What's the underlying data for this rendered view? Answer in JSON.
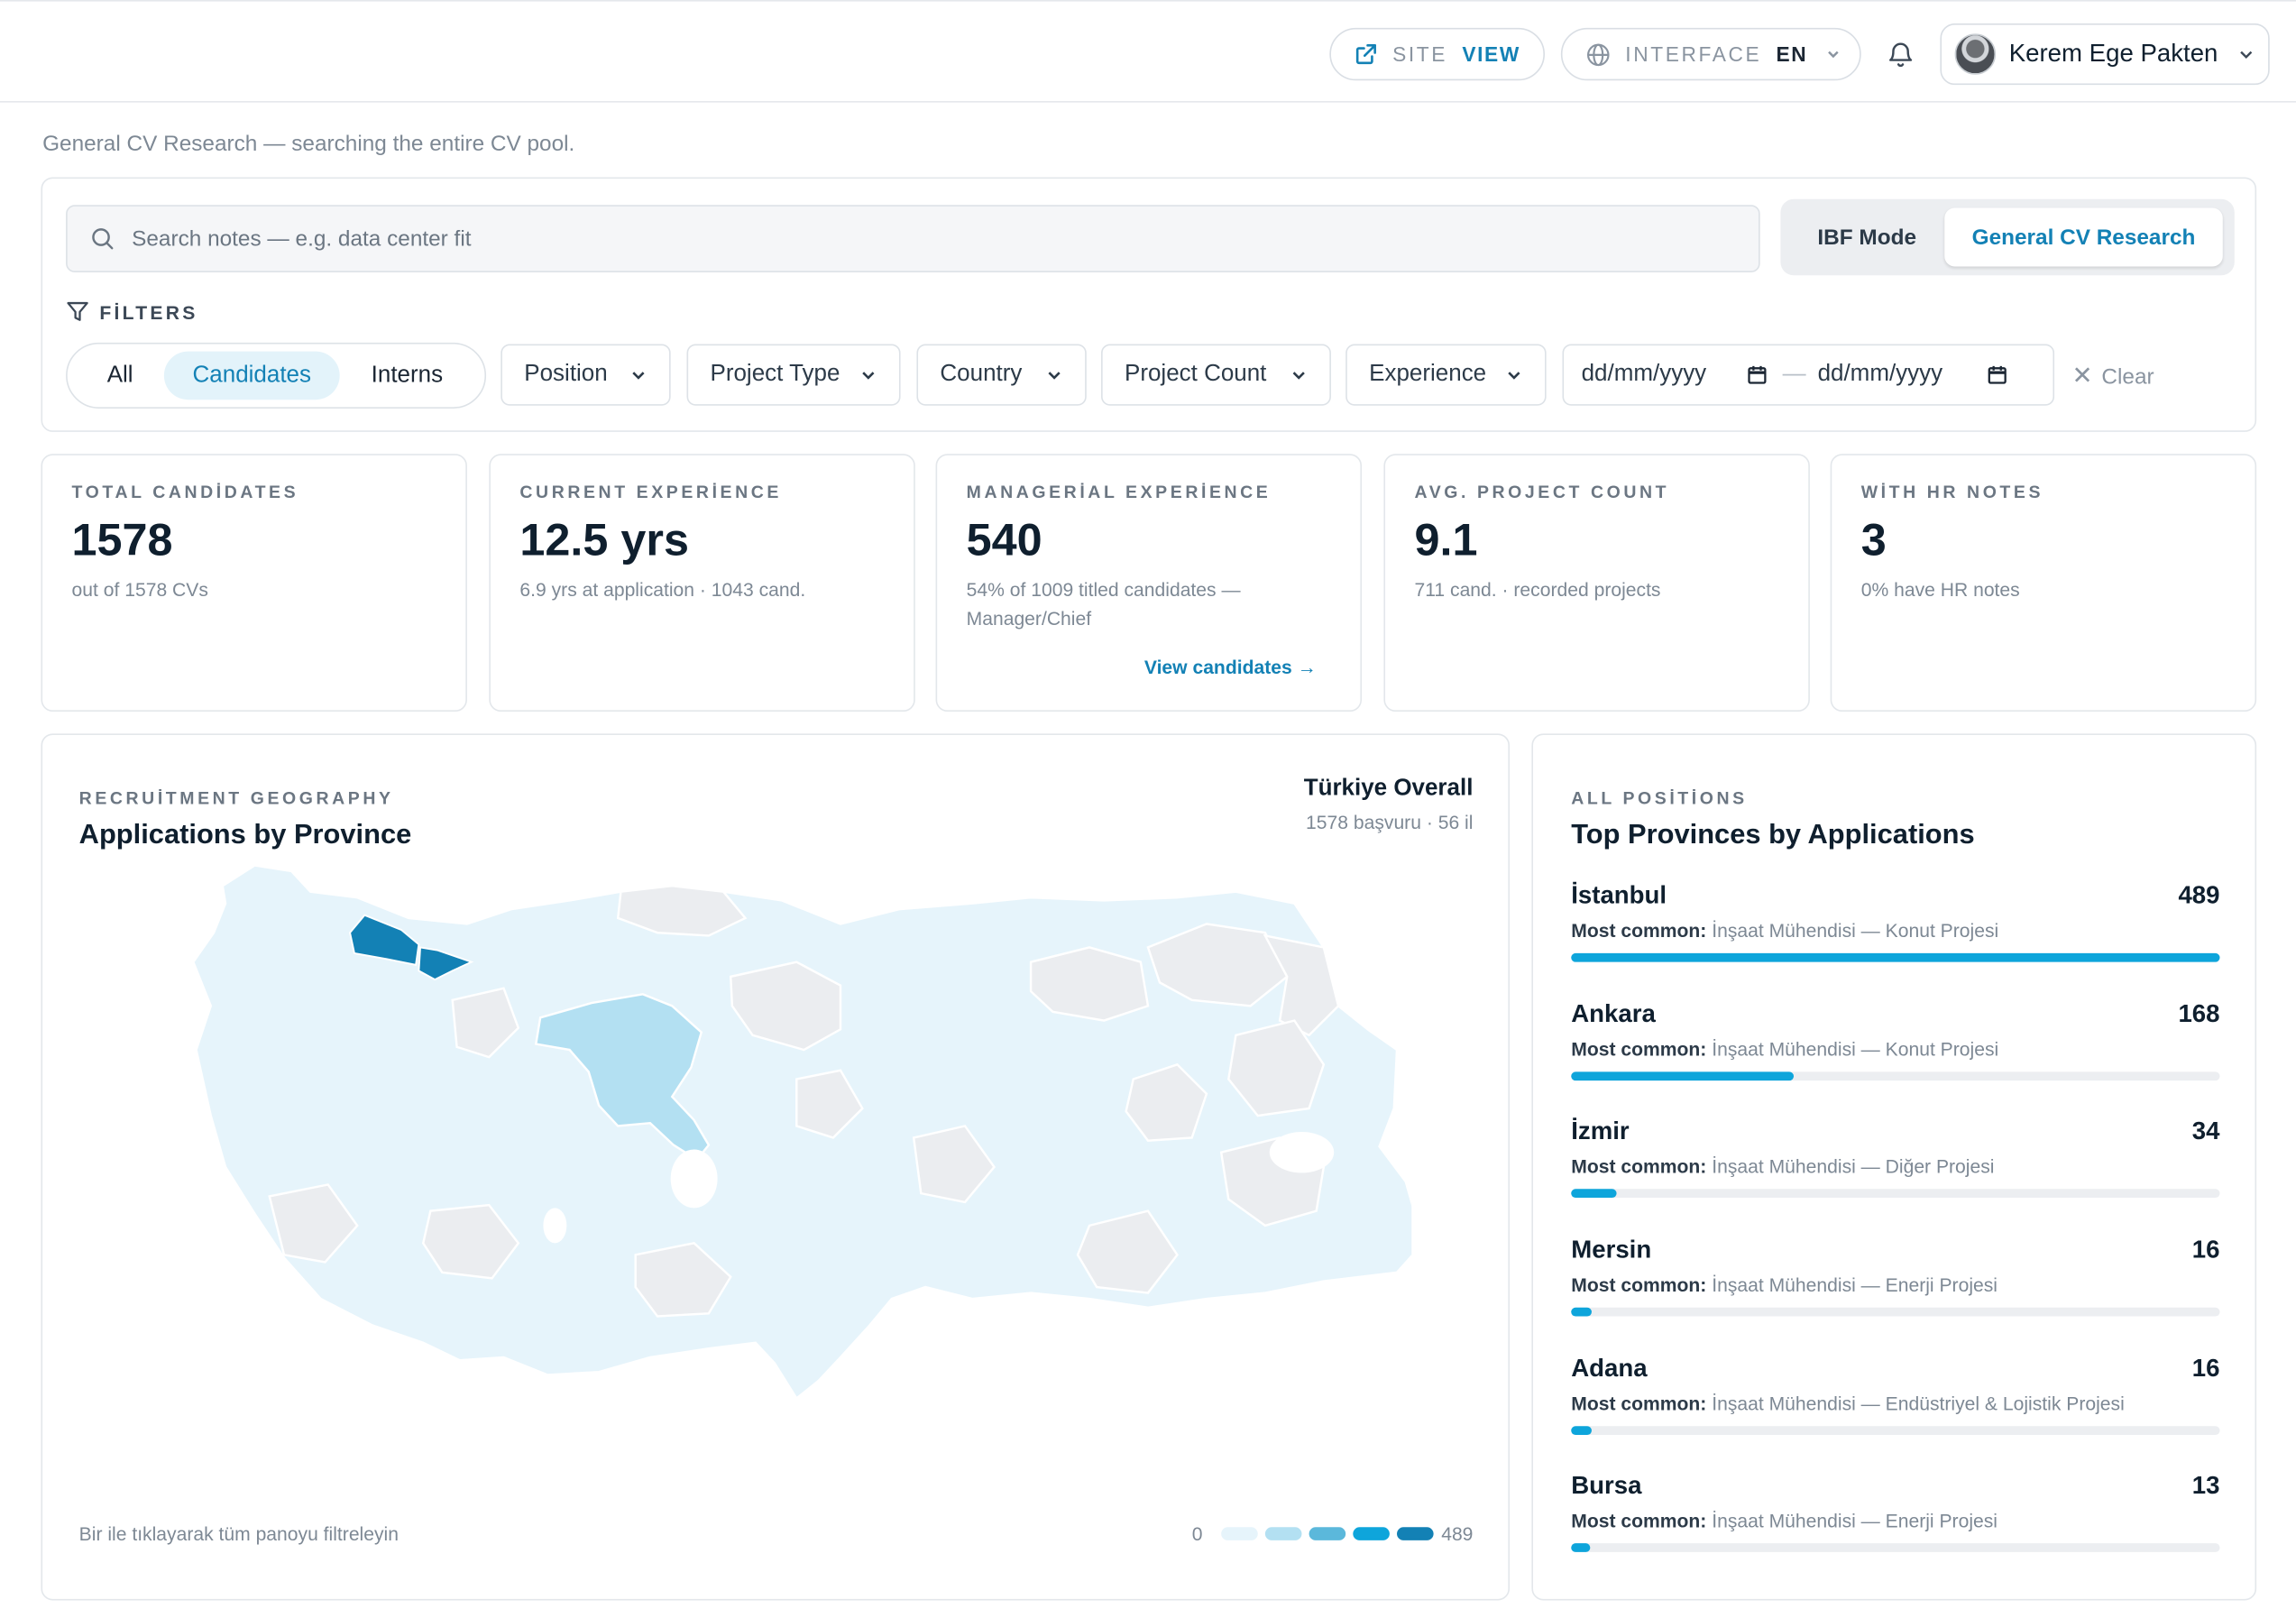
{
  "header": {
    "site_label": "SITE",
    "site_value": "VIEW",
    "interface_label": "INTERFACE",
    "interface_value": "EN",
    "user_name": "Kerem Ege Pakten"
  },
  "page_subtitle": "General CV Research — searching the entire CV pool.",
  "search": {
    "placeholder": "Search notes — e.g. data center fit",
    "value": ""
  },
  "mode_toggle": {
    "ibf": "IBF Mode",
    "general": "General CV Research",
    "active": "general"
  },
  "filters": {
    "label": "FİLTERS",
    "segments": [
      "All",
      "Candidates",
      "Interns"
    ],
    "active_segment": "Candidates",
    "dropdowns": {
      "position": "Position",
      "project_type": "Project Type",
      "country": "Country",
      "project_count": "Project Count",
      "experience": "Experience"
    },
    "date_from_placeholder": "dd/mm/yyyy",
    "date_sep": "—",
    "date_to_placeholder": "dd/mm/yyyy",
    "clear": "Clear"
  },
  "kpis": [
    {
      "label": "TOTAL CANDİDATES",
      "value": "1578",
      "sub": "out of 1578 CVs"
    },
    {
      "label": "CURRENT EXPERİENCE",
      "value": "12.5 yrs",
      "sub": "6.9 yrs at application · 1043 cand."
    },
    {
      "label": "MANAGERİAL EXPERİENCE",
      "value": "540",
      "sub": "54% of 1009 titled candidates — Manager/Chief",
      "link": "View candidates →"
    },
    {
      "label": "AVG. PROJECT COUNT",
      "value": "9.1",
      "sub": "711 cand. · recorded projects"
    },
    {
      "label": "WİTH HR NOTES",
      "value": "3",
      "sub": "0% have HR notes"
    }
  ],
  "map": {
    "section_label": "RECRUİTMENT GEOGRAPHY",
    "title": "Applications by Province",
    "overall_title": "Türkiye Overall",
    "overall_sub": "1578 başvuru · 56 il",
    "hint": "Bir ile tıklayarak tüm panoyu filtreleyin",
    "legend_min": "0",
    "legend_max": "489",
    "legend_colors": [
      "#e6f4fb",
      "#b3e0f2",
      "#5bb8db",
      "#0ea5db",
      "#1381b5"
    ],
    "colors": {
      "empty": "#ebedf0",
      "low": "#e6f4fb",
      "mid": "#b3e0f2",
      "high": "#1381b5"
    }
  },
  "provinces": {
    "section_label": "ALL POSİTİONS",
    "title": "Top Provinces by Applications",
    "common_label": "Most common:",
    "max": 489,
    "items": [
      {
        "name": "İstanbul",
        "count": 489,
        "common": "İnşaat Mühendisi — Konut Projesi"
      },
      {
        "name": "Ankara",
        "count": 168,
        "common": "İnşaat Mühendisi — Konut Projesi"
      },
      {
        "name": "İzmir",
        "count": 34,
        "common": "İnşaat Mühendisi — Diğer Projesi"
      },
      {
        "name": "Mersin",
        "count": 16,
        "common": "İnşaat Mühendisi — Enerji Projesi"
      },
      {
        "name": "Adana",
        "count": 16,
        "common": "İnşaat Mühendisi — Endüstriyel & Lojistik Projesi"
      },
      {
        "name": "Bursa",
        "count": 13,
        "common": "İnşaat Mühendisi — Enerji Projesi"
      }
    ]
  }
}
